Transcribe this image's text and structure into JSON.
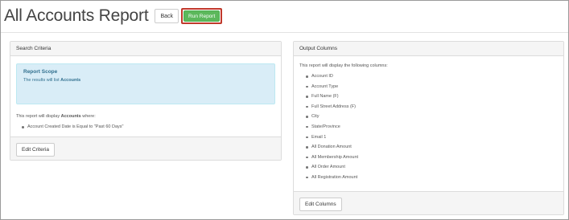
{
  "header": {
    "title": "All Accounts Report",
    "back_label": "Back",
    "run_label": "Run Report"
  },
  "search_criteria": {
    "heading": "Search Criteria",
    "scope": {
      "title": "Report Scope",
      "text_prefix": "The results will list",
      "text_bold": "Accounts"
    },
    "intro_prefix": "This report will display",
    "intro_bold": "Accounts",
    "intro_suffix": "where:",
    "criteria": [
      "Account Created Date is Equal to \"Past 60 Days\""
    ],
    "edit_label": "Edit Criteria"
  },
  "output_columns": {
    "heading": "Output Columns",
    "intro": "This report will display the following columns:",
    "columns": [
      "Account ID",
      "Account Type",
      "Full Name (F)",
      "Full Street Address (F)",
      "City",
      "State/Province",
      "Email 1",
      "All Donation Amount",
      "All Membership Amount",
      "All Order Amount",
      "All Registration Amount"
    ],
    "edit_label": "Edit Columns"
  },
  "colors": {
    "run_button": "#5cb85c",
    "highlight_border": "#c0392b",
    "info_box": "#d9edf7",
    "info_text": "#31708f"
  }
}
